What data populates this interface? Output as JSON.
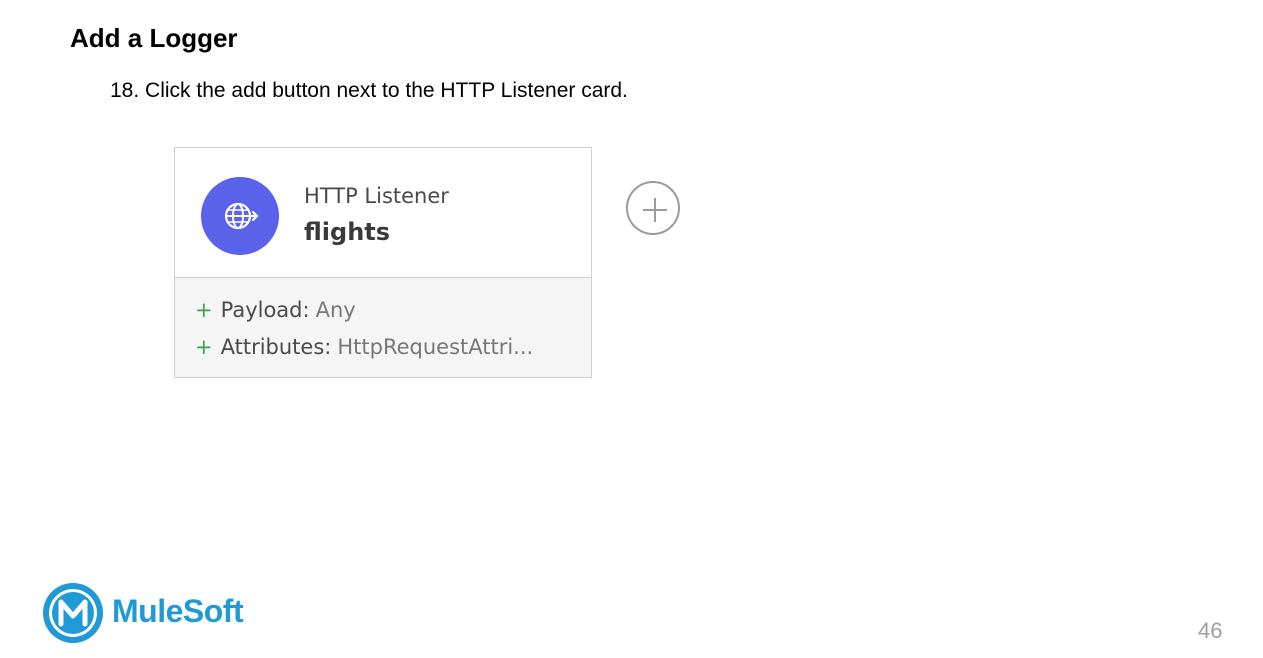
{
  "slide": {
    "title": "Add a Logger",
    "step": "18. Click the add button next to the HTTP Listener card.",
    "page_number": "46"
  },
  "card": {
    "icon": "globe-arrow-icon",
    "name": "HTTP Listener",
    "subtitle": "flights",
    "rows": [
      {
        "key": "Payload:",
        "value": "Any"
      },
      {
        "key": "Attributes:",
        "value": "HttpRequestAttri..."
      }
    ]
  },
  "add_button": {
    "icon": "plus-circle-icon"
  },
  "brand": {
    "name": "MuleSoft",
    "color": "#1f9ad7"
  },
  "colors": {
    "icon_bg": "#5a62ea",
    "plus": "#3fa34d"
  }
}
